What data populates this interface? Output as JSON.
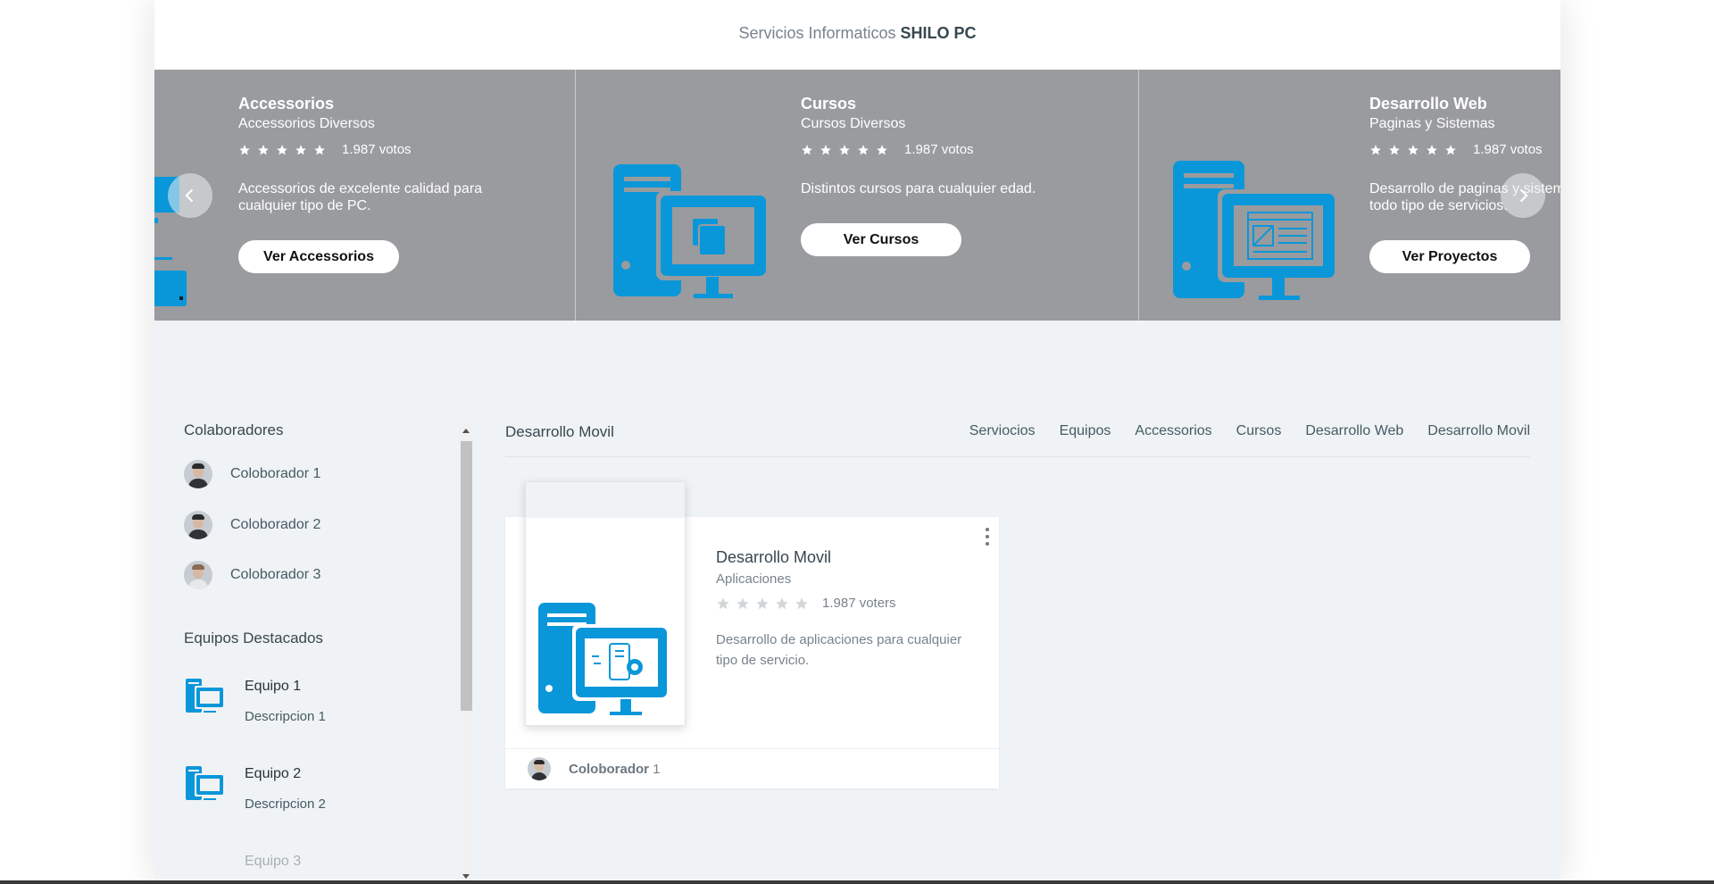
{
  "header": {
    "brand_prefix": "Servicios Informaticos",
    "brand_name": "SHILO PC"
  },
  "carousel": {
    "slides": [
      {
        "title": "Accessorios",
        "subtitle": "Accessorios Diversos",
        "stars": 5,
        "votes": "1.987 votos",
        "desc_line1": "Accessorios de excelente calidad para",
        "desc_line2": "cualquier tipo de PC.",
        "cta": "Ver Accessorios"
      },
      {
        "title": "Cursos",
        "subtitle": "Cursos Diversos",
        "stars": 5,
        "votes": "1.987 votos",
        "desc_line1": "Distintos cursos para cualquier edad.",
        "cta": "Ver Cursos"
      },
      {
        "title": "Desarrollo Web",
        "subtitle": "Paginas y Sistemas",
        "stars": 5,
        "votes": "1.987 votos",
        "desc_line1": "Desarrollo de paginas y sistemas",
        "desc_line2": "todo tipo de servicios.",
        "cta": "Ver Proyectos"
      }
    ],
    "prev_icon": "chevron-left-icon",
    "next_icon": "chevron-right-icon"
  },
  "sidebar": {
    "collaborators_heading": "Colaboradores",
    "collaborators": [
      "Coloborador 1",
      "Coloborador 2",
      "Coloborador 3"
    ],
    "featured_heading": "Equipos Destacados",
    "featured": [
      {
        "title": "Equipo 1",
        "desc": "Descripcion 1"
      },
      {
        "title": "Equipo 2",
        "desc": "Descripcion 2"
      },
      {
        "title": "Equipo 3"
      }
    ]
  },
  "main": {
    "current_section": "Desarrollo Movil",
    "tabs": [
      "Serviocios",
      "Equipos",
      "Accessorios",
      "Cursos",
      "Desarrollo Web",
      "Desarrollo Movil"
    ],
    "card": {
      "title": "Desarrollo Movil",
      "subtitle": "Aplicaciones",
      "stars_filled": 0,
      "votes": "1.987 voters",
      "desc": "Desarrollo de aplicaciones para cualquier tipo de servicio.",
      "author_name": "Coloborador",
      "author_num": "1",
      "menu_icon": "more-vertical-icon"
    }
  },
  "colors": {
    "accent": "#0a97d9",
    "carousel_bg": "#999b9e",
    "page_bg": "#f0f3f5"
  }
}
